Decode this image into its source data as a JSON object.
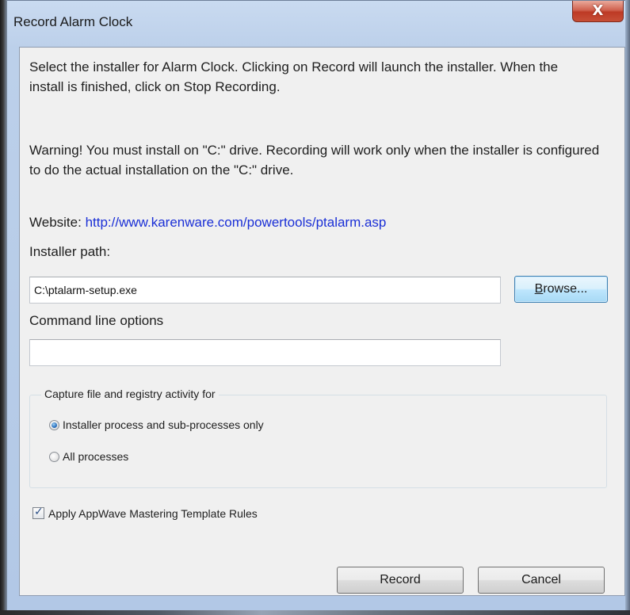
{
  "window": {
    "title": "Record Alarm Clock",
    "close_symbol": "X"
  },
  "instructions": {
    "intro": "Select the installer for Alarm Clock.  Clicking on Record will launch the installer.  When the install is finished, click on Stop Recording.",
    "warning": "Warning! You must install on \"C:\" drive. Recording will work only when the installer is configured to do the actual installation on the \"C:\" drive."
  },
  "website": {
    "label": "Website:",
    "url": "http://www.karenware.com/powertools/ptalarm.asp"
  },
  "installer_path": {
    "label": "Installer path:",
    "value": "C:\\ptalarm-setup.exe",
    "browse_label": "Browse..."
  },
  "command_line": {
    "label": "Command line options",
    "value": ""
  },
  "capture": {
    "group_label": "Capture file and registry activity for",
    "options": [
      {
        "label": "Installer process and sub-processes only",
        "checked": true
      },
      {
        "label": "All processes",
        "checked": false
      }
    ]
  },
  "template_rules": {
    "label": "Apply AppWave Mastering Template Rules",
    "checked": true
  },
  "buttons": {
    "record": "Record",
    "cancel": "Cancel"
  },
  "colors": {
    "link": "#1a2fd6",
    "close_button": "#c74f37",
    "frame": "#bcd0ea",
    "client_bg": "#f0f0f0"
  }
}
